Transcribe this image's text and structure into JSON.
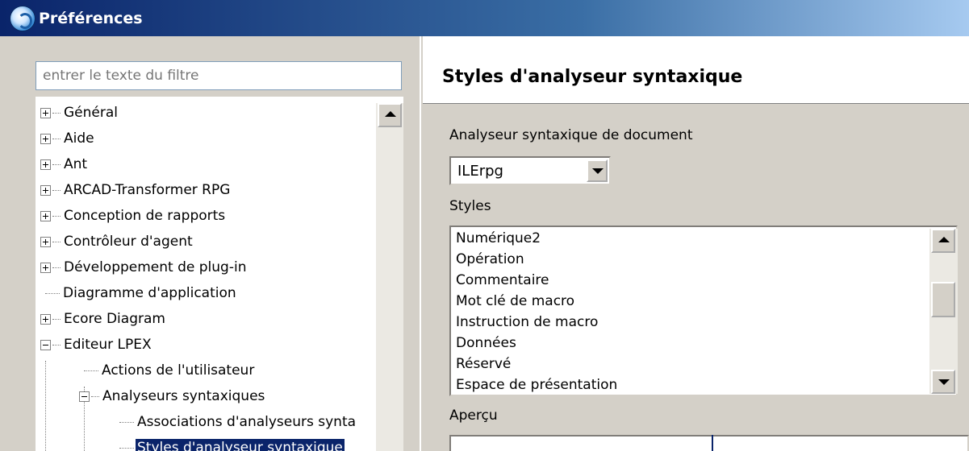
{
  "window": {
    "title": "Préférences",
    "icon": "app-icon"
  },
  "filter": {
    "placeholder": "entrer le texte du filtre"
  },
  "tree": {
    "items": [
      {
        "label": "Général",
        "expander": "plus"
      },
      {
        "label": "Aide",
        "expander": "plus"
      },
      {
        "label": "Ant",
        "expander": "plus"
      },
      {
        "label": "ARCAD-Transformer RPG",
        "expander": "plus"
      },
      {
        "label": "Conception de rapports",
        "expander": "plus"
      },
      {
        "label": "Contrôleur d'agent",
        "expander": "plus"
      },
      {
        "label": "Développement de plug-in",
        "expander": "plus"
      },
      {
        "label": "Diagramme d'application",
        "expander": "none"
      },
      {
        "label": "Ecore Diagram",
        "expander": "plus"
      },
      {
        "label": "Editeur LPEX",
        "expander": "minus"
      },
      {
        "label": "Actions de l'utilisateur",
        "expander": "none"
      },
      {
        "label": "Analyseurs syntaxiques",
        "expander": "minus"
      },
      {
        "label": "Associations d'analyseurs synta",
        "expander": "none"
      },
      {
        "label": "Styles d'analyseur syntaxique",
        "expander": "none",
        "selected": true
      }
    ]
  },
  "page": {
    "title": "Styles d'analyseur syntaxique",
    "parser_label": "Analyseur syntaxique de document",
    "parser_value": "ILErpg",
    "styles_label": "Styles",
    "styles": [
      "Numérique2",
      "Opération",
      "Commentaire",
      "Mot clé de macro",
      "Instruction de macro",
      "Données",
      "Réservé",
      "Espace de présentation"
    ],
    "preview_label": "Aperçu"
  },
  "colors": {
    "selection": "#0a246a",
    "titlebar_start": "#0a246a",
    "titlebar_end": "#a6caf0",
    "face": "#d4d0c8"
  }
}
